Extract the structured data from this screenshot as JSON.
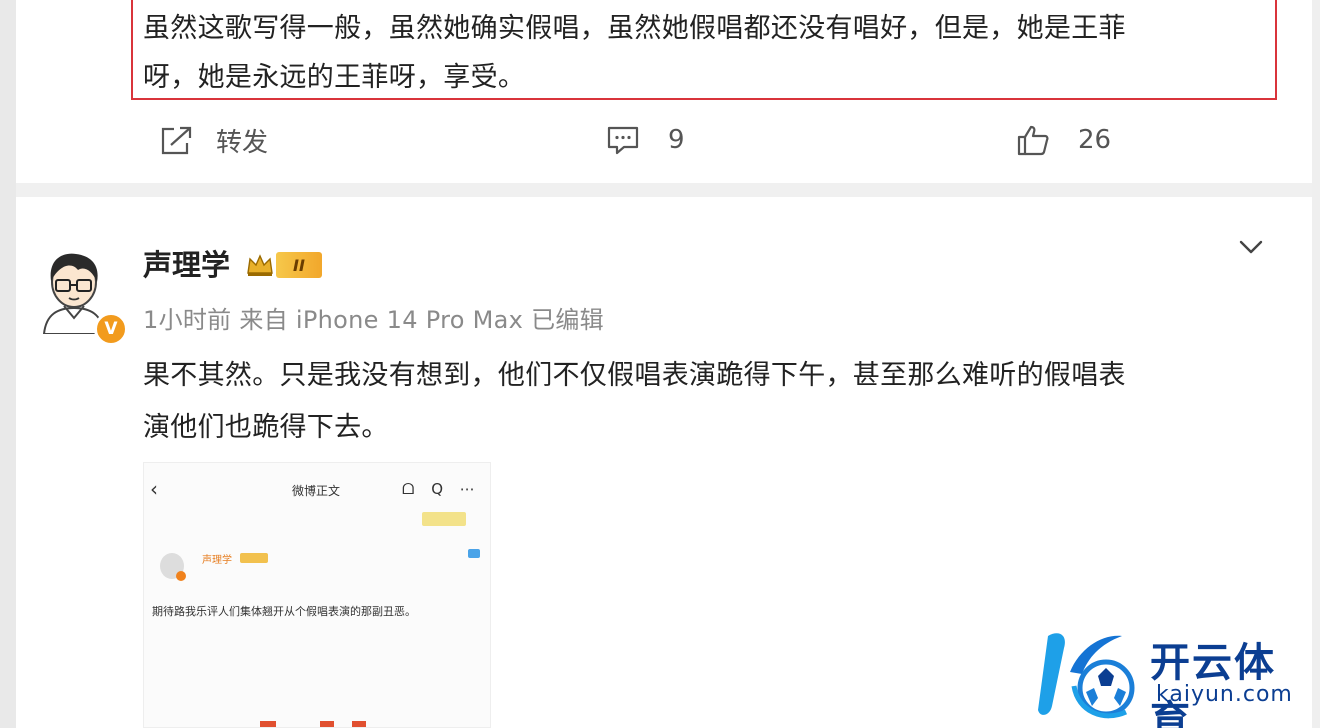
{
  "top_post": {
    "quote_line1": "虽然这歌写得一般，虽然她确实假唱，虽然她假唱都还没有唱好，但是，她是王菲",
    "quote_line2": "呀，她是永远的王菲呀，享受。",
    "repost_label": "转发",
    "comment_count": "9",
    "like_count": "26"
  },
  "post": {
    "user_name": "声理学",
    "verified_mark": "V",
    "badge_level": "II",
    "meta": "1小时前  来自 iPhone 14 Pro Max 已编辑",
    "text_line1": "果不其然。只是我没有想到，他们不仅假唱表演跪得下午，甚至那么难听的假唱表",
    "text_line2": "演他们也跪得下去。"
  },
  "embedded_screenshot": {
    "back": "‹",
    "title": "微博正文",
    "icons": "ᗝ Q ⋯",
    "name": "声理学",
    "body": "期待路我乐评人们集体翘开从个假唱表演的那副丑恶。"
  },
  "watermark": {
    "brand": "开云体育",
    "url": "kaiyun.com",
    "colors": {
      "primary": "#0b3e92",
      "accent": "#1ea0e8"
    }
  },
  "colors": {
    "highlight_border": "#d9343b",
    "verified": "#f29b1d",
    "meta_gray": "#8a8a8a"
  }
}
